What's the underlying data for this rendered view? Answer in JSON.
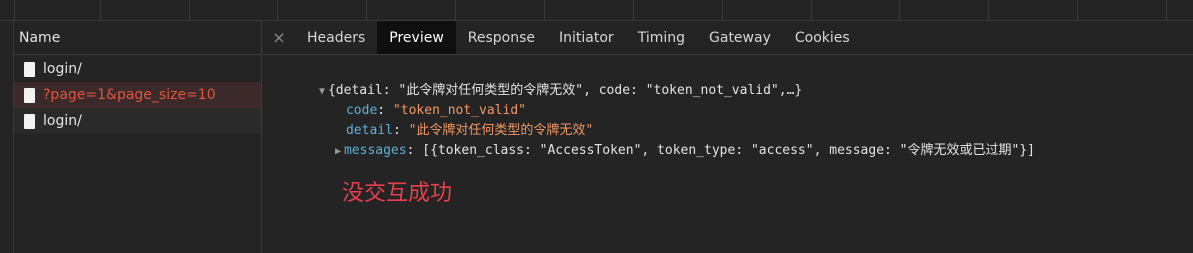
{
  "left_panel": {
    "header": "Name",
    "requests": [
      {
        "label": "login/",
        "state": "normal"
      },
      {
        "label": "?page=1&page_size=10",
        "state": "error"
      },
      {
        "label": "login/",
        "state": "normal"
      }
    ]
  },
  "tabs": {
    "close_glyph": "×",
    "items": [
      "Headers",
      "Preview",
      "Response",
      "Initiator",
      "Timing",
      "Gateway",
      "Cookies"
    ],
    "active": "Preview"
  },
  "preview": {
    "summary": {
      "open": "{",
      "k1": "detail",
      "v1": "\"此令牌对任何类型的令牌无效\"",
      "k2": "code",
      "v2": "\"token_not_valid\"",
      "close": ",…}"
    },
    "code": {
      "key": "code",
      "value": "\"token_not_valid\""
    },
    "detail": {
      "key": "detail",
      "value": "\"此令牌对任何类型的令牌无效\""
    },
    "messages": {
      "key": "messages",
      "value": "[{token_class: \"AccessToken\", token_type: \"access\", message: \"令牌无效或已过期\"}]"
    }
  },
  "annotation": "没交互成功",
  "colors": {
    "background": "#242424",
    "key": "#5db0d7",
    "string": "#f29766",
    "error": "#e0563f",
    "annotation": "#e8404c"
  }
}
